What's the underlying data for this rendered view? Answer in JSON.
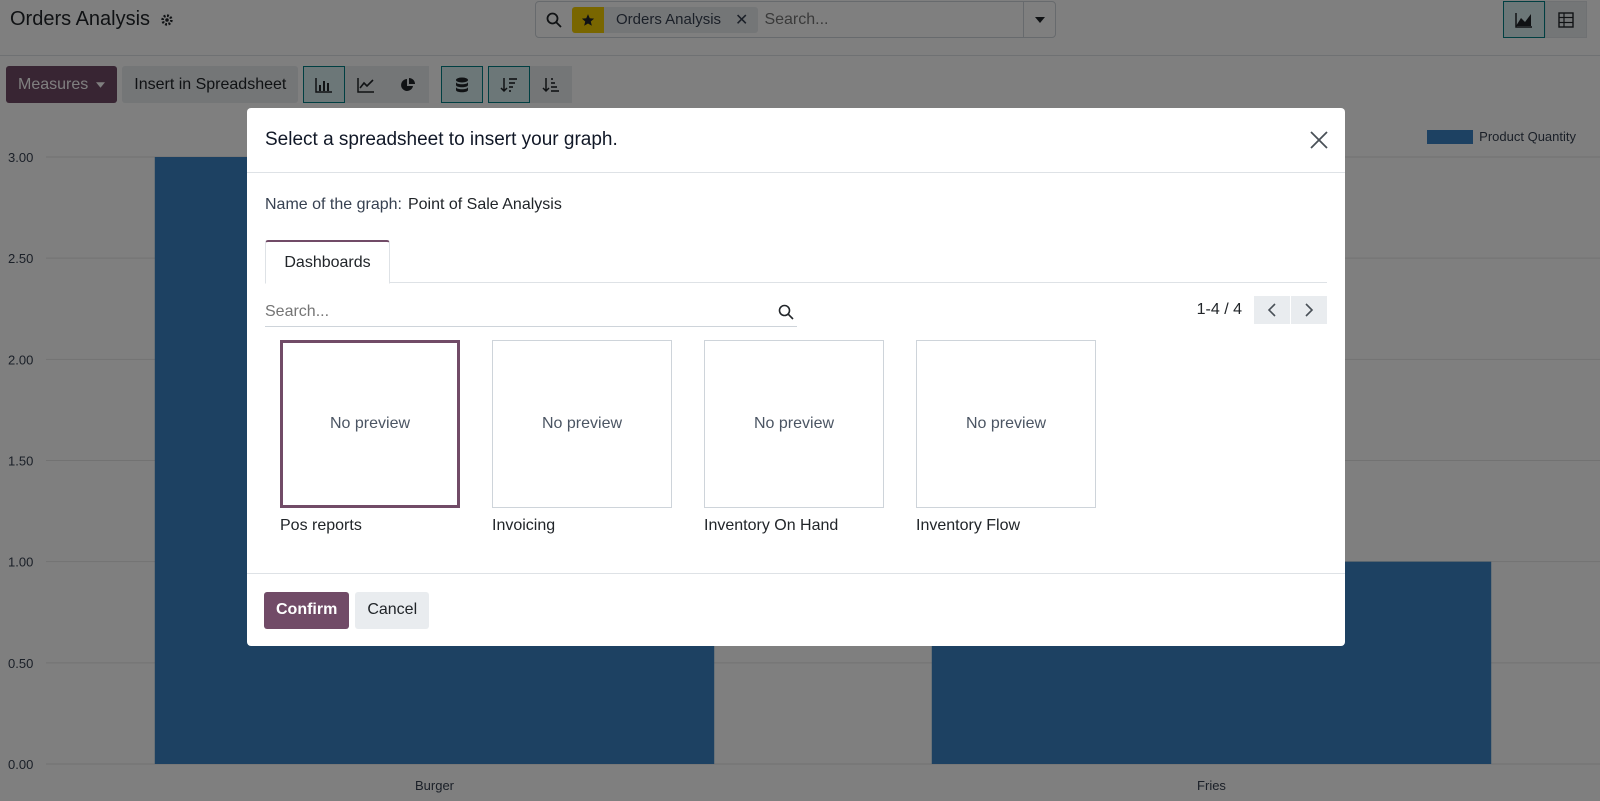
{
  "app": {
    "title": "Orders Analysis",
    "search": {
      "facet_label": "Orders Analysis",
      "placeholder": "Search..."
    },
    "toolbar": {
      "measures_label": "Measures",
      "insert_label": "Insert in Spreadsheet"
    },
    "colors": {
      "brand": "#714b67",
      "bar": "#3a83c4",
      "facet_star": "#f3cc00",
      "active_view": "#017e84"
    }
  },
  "chart_data": {
    "type": "bar",
    "categories": [
      "Burger",
      "Fries"
    ],
    "series": [
      {
        "name": "Product Quantity",
        "values": [
          3,
          1
        ]
      }
    ],
    "ylim": [
      0,
      3
    ],
    "yticks": [
      "0.00",
      "0.50",
      "1.00",
      "1.50",
      "2.00",
      "2.50",
      "3.00"
    ],
    "grid": true,
    "legend_position": "top-right"
  },
  "modal": {
    "title": "Select a spreadsheet to insert your graph.",
    "graph_name_label": "Name of the graph:",
    "graph_name_value": "Point of Sale Analysis",
    "tab_label": "Dashboards",
    "search_placeholder": "Search...",
    "pager": "1-4 / 4",
    "cards": [
      {
        "preview": "No preview",
        "label": "Pos reports",
        "selected": true
      },
      {
        "preview": "No preview",
        "label": "Invoicing",
        "selected": false
      },
      {
        "preview": "No preview",
        "label": "Inventory On Hand",
        "selected": false
      },
      {
        "preview": "No preview",
        "label": "Inventory Flow",
        "selected": false
      }
    ],
    "confirm_label": "Confirm",
    "cancel_label": "Cancel"
  }
}
